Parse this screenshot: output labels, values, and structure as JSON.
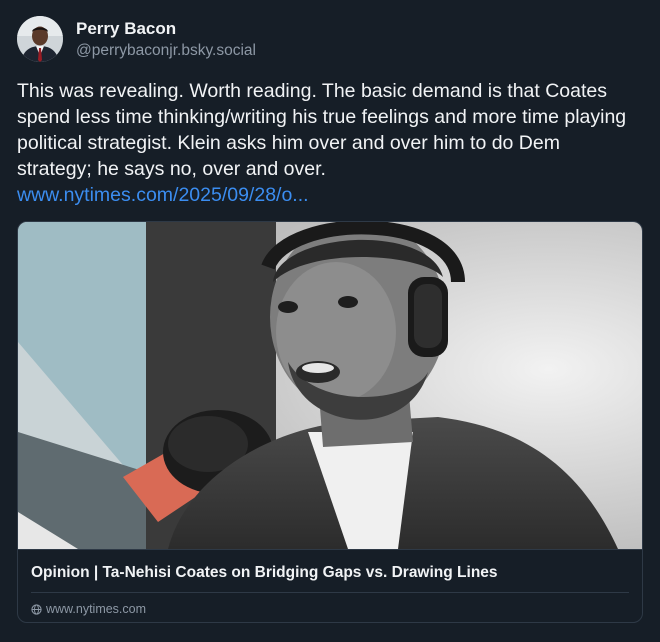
{
  "author": {
    "display_name": "Perry Bacon",
    "handle": "@perrybaconjr.bsky.social"
  },
  "post": {
    "text": "This was revealing. Worth reading. The basic demand is that Coates spend less time thinking/writing his true feelings and more time playing political strategist. Klein asks him over and over him to do Dem strategy; he says no, over and over.",
    "link_text": "www.nytimes.com/2025/09/28/o..."
  },
  "link_card": {
    "title": "Opinion | Ta-Nehisi Coates on Bridging Gaps vs. Drawing Lines",
    "domain": "www.nytimes.com",
    "domain_icon": "globe-icon"
  },
  "colors": {
    "background": "#161e27",
    "text": "#f1f3f5",
    "muted": "#8d98a5",
    "link": "#3b8df0",
    "border": "#2e3946"
  }
}
